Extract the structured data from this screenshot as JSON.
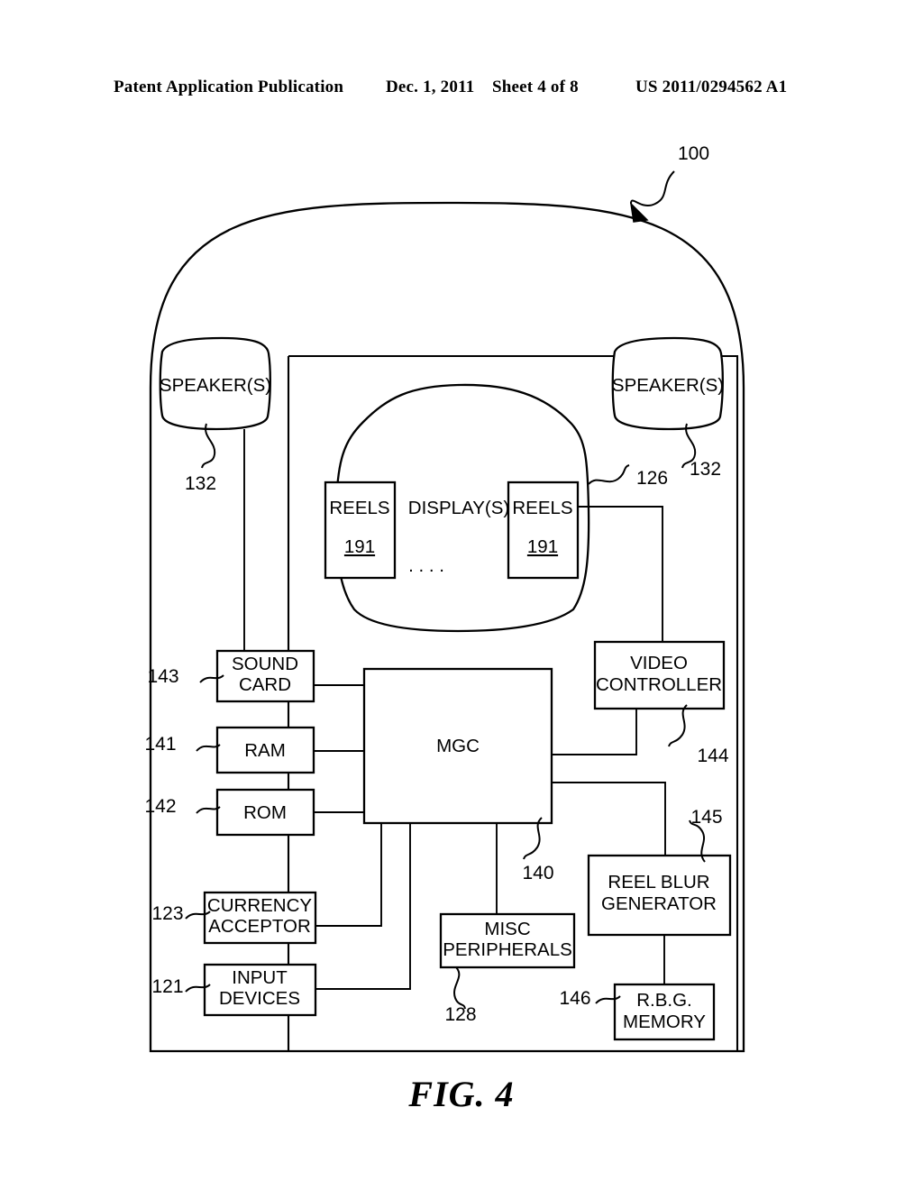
{
  "header": {
    "publication": "Patent Application Publication",
    "date": "Dec. 1, 2011",
    "sheet": "Sheet 4 of 8",
    "patent_number": "US 2011/0294562 A1"
  },
  "figure": {
    "caption": "FIG. 4",
    "assembly_ref": "100"
  },
  "components": {
    "speaker_left": {
      "label": "SPEAKER(S)",
      "ref": "132"
    },
    "speaker_right": {
      "label": "SPEAKER(S)",
      "ref": "132"
    },
    "display": {
      "label": "DISPLAY(S)",
      "ref": "126"
    },
    "reels_left": {
      "label": "REELS",
      "ref": "191"
    },
    "reels_right": {
      "label": "REELS",
      "ref": "191"
    },
    "reels_ellipsis": {
      "label": ". . . ."
    },
    "sound_card": {
      "label_line1": "SOUND",
      "label_line2": "CARD",
      "ref": "143"
    },
    "ram": {
      "label": "RAM",
      "ref": "141"
    },
    "rom": {
      "label": "ROM",
      "ref": "142"
    },
    "currency": {
      "label_line1": "CURRENCY",
      "label_line2": "ACCEPTOR",
      "ref": "123"
    },
    "input_devices": {
      "label_line1": "INPUT",
      "label_line2": "DEVICES",
      "ref": "121"
    },
    "mgc": {
      "label": "MGC",
      "ref": "140"
    },
    "video_ctrl": {
      "label_line1": "VIDEO",
      "label_line2": "CONTROLLER",
      "ref": "144"
    },
    "misc": {
      "label_line1": "MISC",
      "label_line2": "PERIPHERALS",
      "ref": "128"
    },
    "reel_blur": {
      "label_line1": "REEL BLUR",
      "label_line2": "GENERATOR",
      "ref": "145"
    },
    "rbg_memory": {
      "label_line1": "R.B.G.",
      "label_line2": "MEMORY",
      "ref": "146"
    }
  },
  "colors": {
    "ink": "#000000",
    "paper": "#ffffff"
  }
}
